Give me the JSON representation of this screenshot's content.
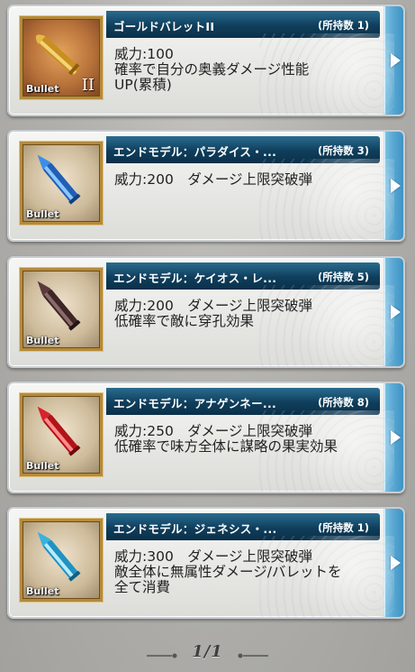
{
  "items": [
    {
      "name": "ゴールドバレットII",
      "count": "(所持数 1)",
      "desc": "威力:100\n確率で自分の奥義ダメージ性能\nUP(累積)",
      "thumb_label": "Bullet",
      "thumb_tier": "II",
      "bullet_icon": "gold-bullet-icon",
      "bullet_color": "#d6a02c"
    },
    {
      "name": "エンドモデル：パラダイス・...",
      "count": "(所持数 3)",
      "desc": "威力:200　ダメージ上限突破弾",
      "thumb_label": "Bullet",
      "thumb_tier": "",
      "bullet_icon": "blue-crystal-bullet-icon",
      "bullet_color": "#2e7fd8"
    },
    {
      "name": "エンドモデル：ケイオス・レ...",
      "count": "(所持数 5)",
      "desc": "威力:200　ダメージ上限突破弾\n低確率で敵に穿孔効果",
      "thumb_label": "Bullet",
      "thumb_tier": "",
      "bullet_icon": "dark-bullet-icon",
      "bullet_color": "#5a3a3a"
    },
    {
      "name": "エンドモデル：アナゲンネー...",
      "count": "(所持数 8)",
      "desc": "威力:250　ダメージ上限突破弾\n低確率で味方全体に謀略の果実効果",
      "thumb_label": "Bullet",
      "thumb_tier": "",
      "bullet_icon": "red-crystal-bullet-icon",
      "bullet_color": "#d8232a"
    },
    {
      "name": "エンドモデル：ジェネシス・...",
      "count": "(所持数 1)",
      "desc": "威力:300　ダメージ上限突破弾\n敵全体に無属性ダメージ/バレットを\n全て消費",
      "thumb_label": "Bullet",
      "thumb_tier": "",
      "bullet_icon": "cyan-crystal-bullet-icon",
      "bullet_color": "#39b3dc"
    }
  ],
  "pager": {
    "text": "1/1"
  },
  "colors": {
    "header": "#0f3e5c",
    "arrow_tab": "#5aa9d4",
    "frame": "#b48a3c"
  }
}
